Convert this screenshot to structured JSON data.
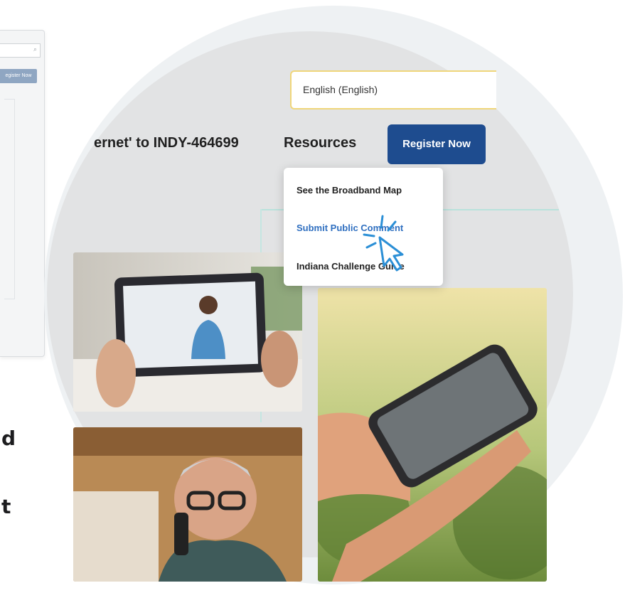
{
  "background_window": {
    "register_label": "egister Now"
  },
  "left_fragments": [
    "d",
    "t"
  ],
  "language_select": {
    "value": "English (English)"
  },
  "nav": {
    "item_1": "ernet' to INDY-464699",
    "item_2": "Resources",
    "register_label": "Register Now"
  },
  "resources_menu": {
    "items": [
      "See the Broadband Map",
      "Submit Public Comment",
      "Indiana Challenge Guide"
    ],
    "active_index": 1
  },
  "colors": {
    "register_bg": "#1e4c8f",
    "active_link": "#2f6fc0",
    "select_border": "#f0d67a",
    "cursor": "#2b8fd6"
  }
}
